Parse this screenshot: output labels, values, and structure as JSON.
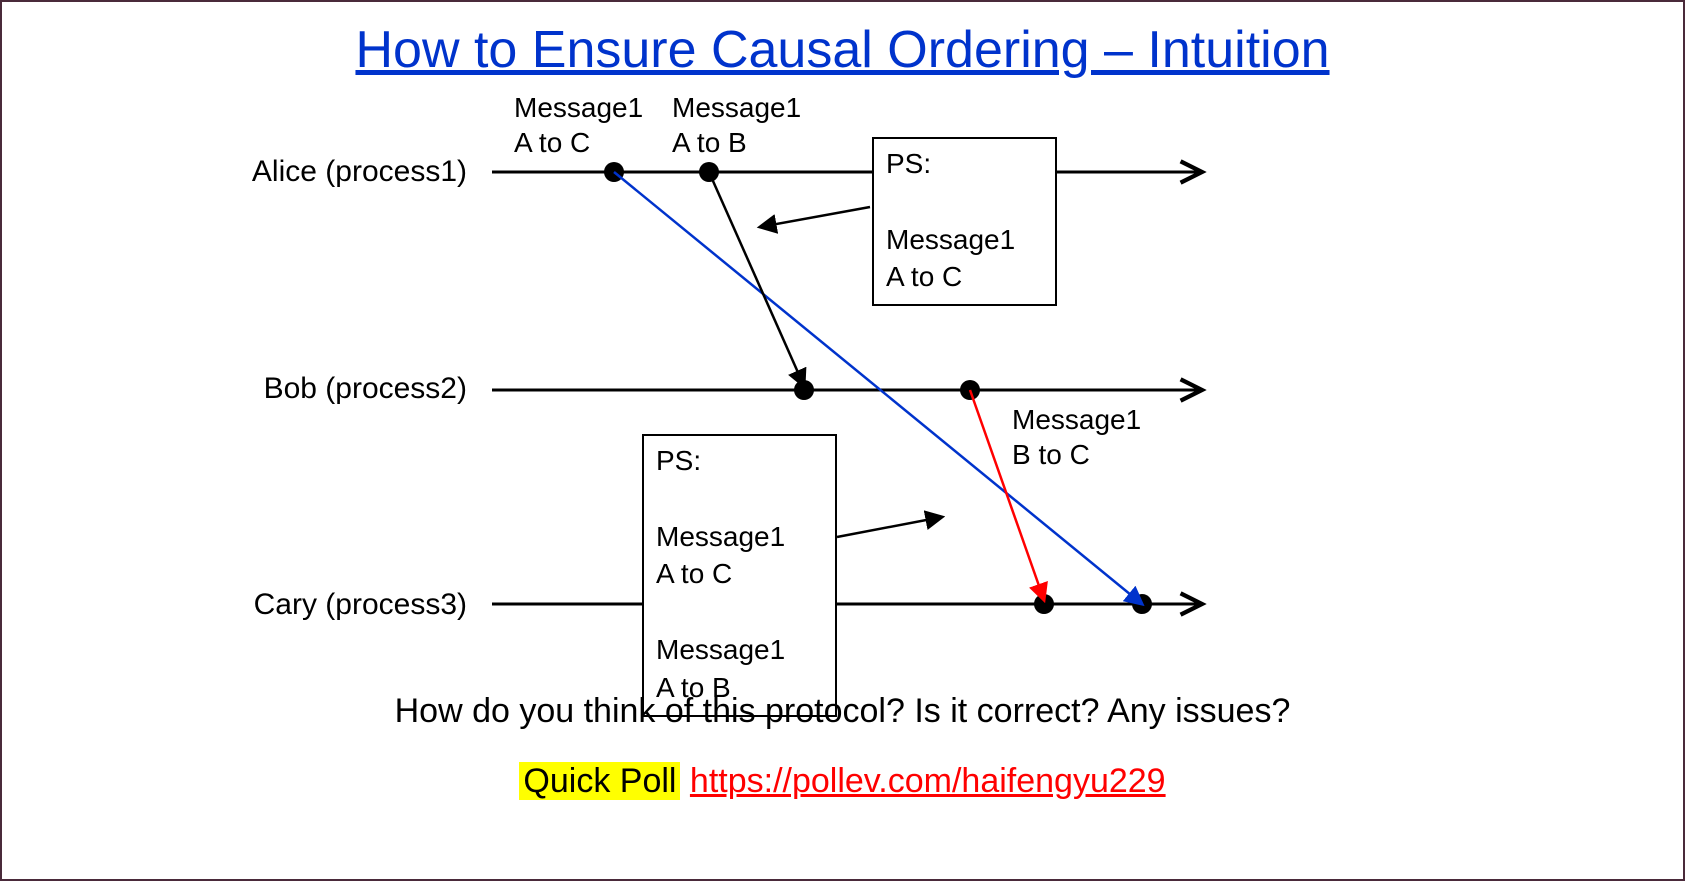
{
  "title": "How to Ensure Causal Ordering – Intuition",
  "processes": {
    "p1": "Alice (process1)",
    "p2": "Bob (process2)",
    "p3": "Cary (process3)"
  },
  "msg_labels": {
    "m1_ac": "Message1\nA to C",
    "m1_ab": "Message1\nA to B",
    "m1_bc": "Message1\nB to C"
  },
  "psA": "PS:\n\nMessage1\nA to C",
  "psB": "PS:\n\nMessage1\nA to C\n\nMessage1\nA to B",
  "question": "How do you think of this protocol? Is it correct? Any issues?",
  "poll_label": "Quick Poll",
  "poll_link": "https://pollev.com/haifengyu229",
  "colors": {
    "title": "#0033cc",
    "link": "#ff0000",
    "highlight": "#ffff00",
    "line_black": "#000000",
    "line_blue": "#0033cc",
    "line_red": "#ff0000"
  }
}
